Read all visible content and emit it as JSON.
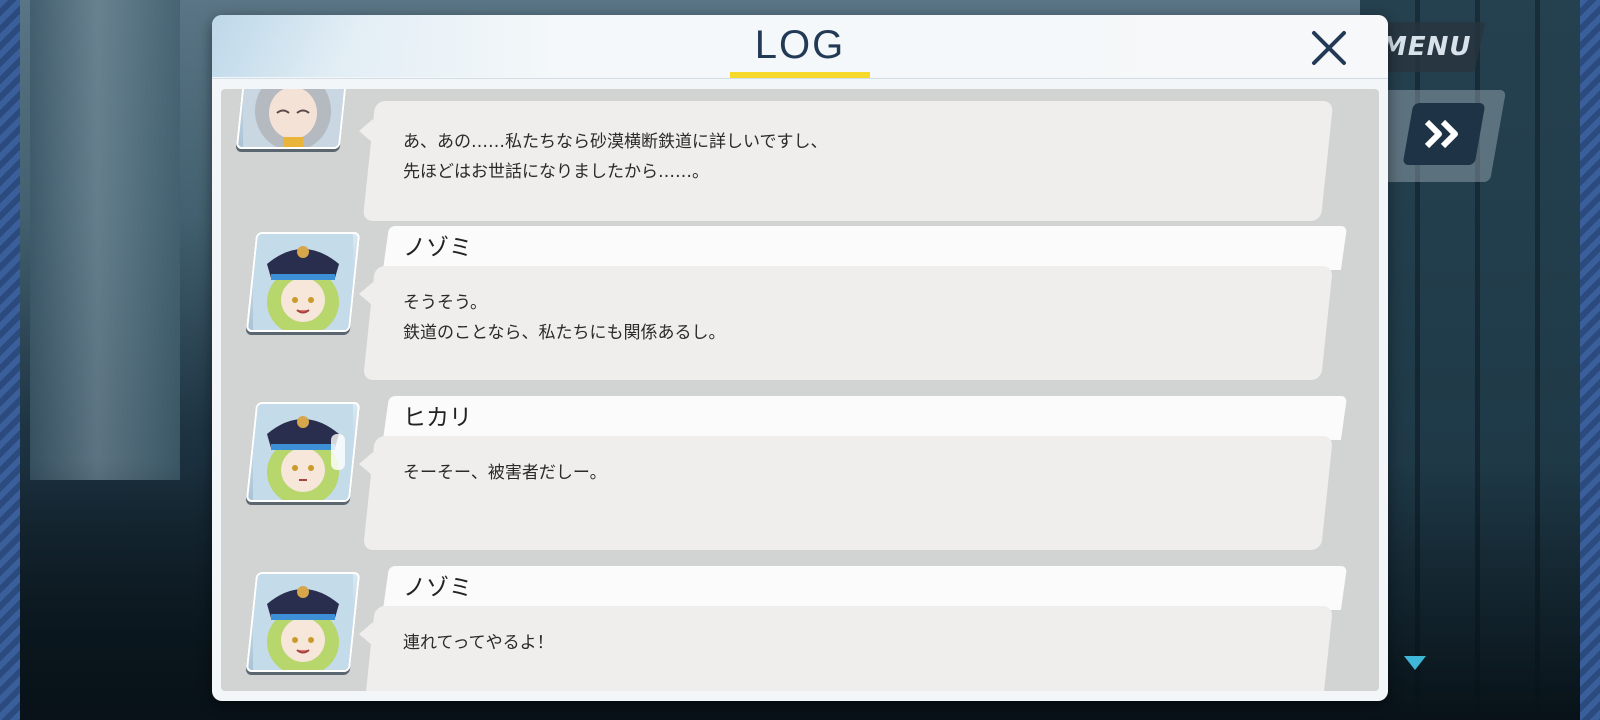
{
  "top_menu": {
    "menu_label": "MENU"
  },
  "dialog": {
    "title": "LOG"
  },
  "entries": [
    {
      "speaker": "",
      "lines": [
        "あ、あの……私たちなら砂漠横断鉄道に詳しいですし、",
        "先ほどはお世話になりましたから……。"
      ],
      "portrait": "gray-haired-girl-portrait"
    },
    {
      "speaker": "ノゾミ",
      "lines": [
        "そうそう。",
        "鉄道のことなら、私たちにも関係あるし。"
      ],
      "portrait": "nozomi-portrait"
    },
    {
      "speaker": "ヒカリ",
      "lines": [
        "そーそー、被害者だしー。"
      ],
      "portrait": "hikari-portrait"
    },
    {
      "speaker": "ノゾミ",
      "lines": [
        "連れてってやるよ！"
      ],
      "portrait": "nozomi-portrait"
    }
  ],
  "colors": {
    "title": "#233a57",
    "underline": "#f6d92a",
    "accent_blue": "#3fb7d8"
  }
}
